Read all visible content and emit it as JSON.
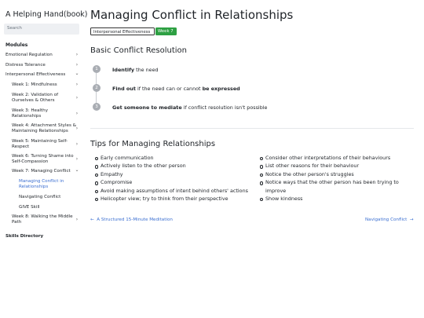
{
  "site": {
    "title": "A Helping Hand(book)"
  },
  "search": {
    "placeholder": "Search"
  },
  "sidebar": {
    "heading": "Modules",
    "items": [
      {
        "label": "Emotional Regulation",
        "chevron": "›"
      },
      {
        "label": "Distress Tolerance",
        "chevron": "›"
      },
      {
        "label": "Interpersonal Effectiveness",
        "chevron": "⌄"
      },
      {
        "label": "Week 1: Mindfulness",
        "chevron": "›"
      },
      {
        "label": "Week 2: Validation of Ourselves & Others",
        "chevron": "›"
      },
      {
        "label": "Week 3: Healthy Relationships",
        "chevron": "›"
      },
      {
        "label": "Week 4: Attachment Styles & Maintaining Relationships",
        "chevron": "›"
      },
      {
        "label": "Week 5: Maintaining Self-Respect",
        "chevron": "›"
      },
      {
        "label": "Week 6: Turning Shame into Self-Compassion",
        "chevron": "›"
      },
      {
        "label": "Week 7: Managing Conflict",
        "chevron": "⌄"
      },
      {
        "label": "Managing Conflict in Relationships"
      },
      {
        "label": "Navigating Conflict"
      },
      {
        "label": "GIVE Skill"
      },
      {
        "label": "Week 8: Walking the Middle Path",
        "chevron": "›"
      }
    ],
    "footer_heading": "Skills Directory"
  },
  "page": {
    "title": "Managing Conflict in Relationships",
    "tags": [
      "Interpersonal Effectiveness",
      "Week 7"
    ]
  },
  "resolution": {
    "heading": "Basic Conflict Resolution",
    "steps": [
      {
        "num": "1",
        "bold": "Identify",
        "rest": " the need"
      },
      {
        "num": "2",
        "bold": "Find out",
        "mid": " if the need can or cannot ",
        "bold2": "be expressed"
      },
      {
        "num": "3",
        "bold": "Get someone to mediate",
        "rest": " if conflict resolution isn't possible"
      }
    ]
  },
  "tips": {
    "heading": "Tips for Managing Relationships",
    "left": [
      "Early communication",
      "Actively listen to the other person",
      "Empathy",
      "Compromise",
      "Avoid making assumptions of intent behind others' actions",
      "Helicopter view; try to think from their perspective"
    ],
    "right": [
      "Consider other interpretations of their behaviours",
      "List other reasons for their behaviour",
      "Notice the other person's struggles",
      "Notice ways that the other person has been trying to improve",
      "Show kindness"
    ]
  },
  "pager": {
    "prev_arrow": "←",
    "prev": "A Structured 15-Minute Meditation",
    "next": "Navigating Conflict",
    "next_arrow": "→"
  },
  "colors": {
    "link": "#3b6fd1",
    "week_badge": "#2ea043",
    "step_circle": "#a9adb3"
  }
}
